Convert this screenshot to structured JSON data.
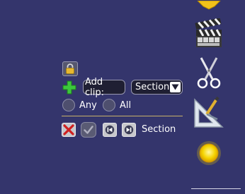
{
  "toolbar": {
    "add_clip_label": "Add clip:",
    "section_select": {
      "selected": "Section"
    }
  },
  "match_mode": {
    "options": [
      {
        "label": "Any",
        "selected": false
      },
      {
        "label": "All",
        "selected": false
      }
    ]
  },
  "section_row": {
    "label": "Section"
  },
  "right_sidebar": {
    "icons": [
      "star-icon",
      "clapperboard-icon",
      "scissors-icon",
      "geometry-tools-icon",
      "sun-icon"
    ]
  },
  "colors": {
    "background": "#34356c",
    "divider": "#c9b26a",
    "accent_green": "#3cc83c",
    "delete_red": "#d02020"
  }
}
